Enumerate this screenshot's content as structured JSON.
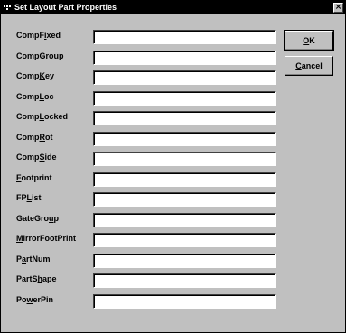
{
  "window": {
    "title": "Set Layout Part Properties",
    "close_glyph": "×"
  },
  "buttons": {
    "ok": "OK",
    "ok_mnemonic_index": 0,
    "cancel": "Cancel",
    "cancel_mnemonic_index": 0
  },
  "fields": [
    {
      "label": "CompFixed",
      "m": 5,
      "value": ""
    },
    {
      "label": "CompGroup",
      "m": 4,
      "value": ""
    },
    {
      "label": "CompKey",
      "m": 4,
      "value": ""
    },
    {
      "label": "CompLoc",
      "m": 4,
      "value": ""
    },
    {
      "label": "CompLocked",
      "m": 4,
      "value": ""
    },
    {
      "label": "CompRot",
      "m": 4,
      "value": ""
    },
    {
      "label": "CompSide",
      "m": 4,
      "value": ""
    },
    {
      "label": "Footprint",
      "m": 0,
      "value": ""
    },
    {
      "label": "FPList",
      "m": 2,
      "value": ""
    },
    {
      "label": "GateGroup",
      "m": 7,
      "value": ""
    },
    {
      "label": "MirrorFootPrint",
      "m": 0,
      "value": ""
    },
    {
      "label": "PartNum",
      "m": 1,
      "value": ""
    },
    {
      "label": "PartShape",
      "m": 5,
      "value": ""
    },
    {
      "label": "PowerPin",
      "m": 2,
      "value": ""
    }
  ]
}
